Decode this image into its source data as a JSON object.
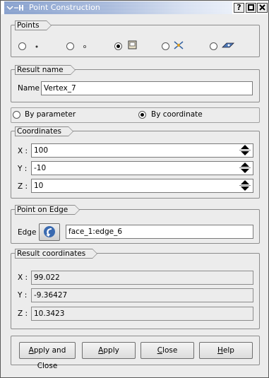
{
  "window": {
    "title": "Point Construction",
    "title_icon": "window-menu-icon",
    "controls": [
      "?",
      "□",
      "✕"
    ]
  },
  "points_group": {
    "label": "Points",
    "options": [
      {
        "icon": "point-by-dot-icon",
        "selected": false
      },
      {
        "icon": "point-by-small-dot-icon",
        "selected": false
      },
      {
        "icon": "point-on-face-icon",
        "selected": true
      },
      {
        "icon": "point-intersection-icon",
        "selected": false
      },
      {
        "icon": "point-on-plane-icon",
        "selected": false
      }
    ]
  },
  "result_name": {
    "label": "Result name",
    "field_label": "Name",
    "value": "Vertex_7"
  },
  "mode": {
    "by_parameter": "By parameter",
    "by_coordinate": "By coordinate",
    "selected": "by_coordinate"
  },
  "coordinates": {
    "label": "Coordinates",
    "x_label": "X :",
    "x_value": "100",
    "y_label": "Y :",
    "y_value": "-10",
    "z_label": "Z :",
    "z_value": "10"
  },
  "point_on_edge": {
    "label": "Point on Edge",
    "field_label": "Edge",
    "value": "face_1:edge_6"
  },
  "result_coordinates": {
    "label": "Result coordinates",
    "x_label": "X :",
    "x_value": "99.022",
    "y_label": "Y :",
    "y_value": "-9.36427",
    "z_label": "Z :",
    "z_value": "10.3423"
  },
  "buttons": {
    "apply_close_pre": "",
    "apply_close_u": "A",
    "apply_close_post": "pply and Close",
    "apply_u": "A",
    "apply_post": "pply",
    "close_u": "C",
    "close_post": "lose",
    "help_u": "H",
    "help_post": "elp"
  }
}
